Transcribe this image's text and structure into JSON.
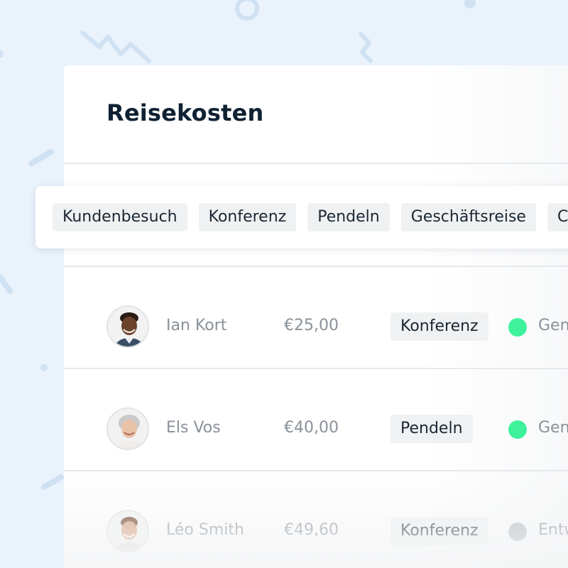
{
  "page": {
    "title": "Reisekosten"
  },
  "filters": {
    "chips": [
      "Kundenbesuch",
      "Konferenz",
      "Pendeln",
      "Geschäftsreise",
      "Co"
    ]
  },
  "rows": [
    {
      "name": "Ian Kort",
      "amount": "€25,00",
      "category": "Konferenz",
      "status": "Gen",
      "status_color": "#3ef29b",
      "avatar": "avatar-man-dark"
    },
    {
      "name": "Els Vos",
      "amount": "€40,00",
      "category": "Pendeln",
      "status": "Gen",
      "status_color": "#3ef29b",
      "avatar": "avatar-woman-grey"
    },
    {
      "name": "Léo Smith",
      "amount": "€49,60",
      "category": "Konferenz",
      "status": "Entw",
      "status_color": "#b3b9c0",
      "avatar": "avatar-man-light"
    }
  ],
  "colors": {
    "background": "#eaf2fb",
    "decor": "#cfe1f3",
    "approved": "#3ef29b",
    "draft": "#b3b9c0"
  }
}
